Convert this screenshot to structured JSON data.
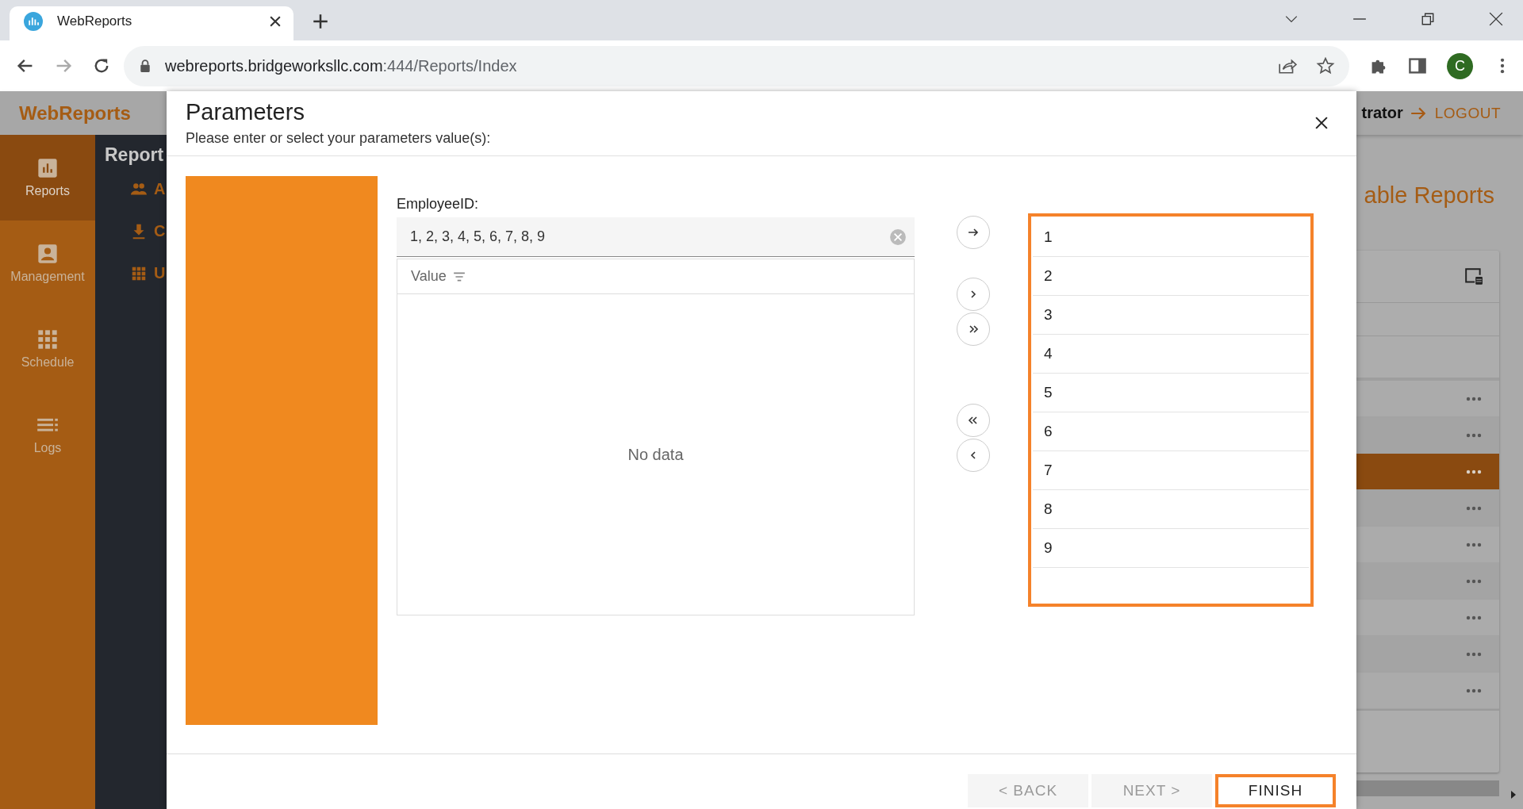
{
  "browser": {
    "tab_title": "WebReports",
    "url_host": "webreports.bridgeworksllc.com",
    "url_path": ":444/Reports/Index",
    "profile_initial": "C"
  },
  "app": {
    "brand": "WebReports",
    "user_fragment": "trator",
    "logout": "LOGOUT",
    "nav": [
      {
        "label": "Reports",
        "selected": true
      },
      {
        "label": "Management",
        "selected": false
      },
      {
        "label": "Schedule",
        "selected": false
      },
      {
        "label": "Logs",
        "selected": false
      }
    ],
    "subnav": {
      "title": "Report",
      "items": [
        {
          "label": "A"
        },
        {
          "label": "C"
        },
        {
          "label": "U"
        }
      ]
    },
    "page_title": "able Reports",
    "report_rows": [
      {
        "selected": false
      },
      {
        "selected": false
      },
      {
        "selected": true
      },
      {
        "selected": false
      },
      {
        "selected": false
      },
      {
        "selected": false
      },
      {
        "selected": false
      },
      {
        "selected": false
      },
      {
        "selected": false
      }
    ]
  },
  "dialog": {
    "title": "Parameters",
    "subtitle": "Please enter or select your parameters value(s):",
    "param_label": "EmployeeID:",
    "value": "1, 2, 3, 4, 5, 6, 7, 8, 9",
    "grid_column": "Value",
    "empty_text": "No data",
    "selected_values": [
      "1",
      "2",
      "3",
      "4",
      "5",
      "6",
      "7",
      "8",
      "9"
    ],
    "buttons": [
      {
        "label": "< BACK",
        "disabled": true
      },
      {
        "label": "NEXT >",
        "disabled": true
      },
      {
        "label": "FINISH",
        "disabled": false
      }
    ]
  }
}
